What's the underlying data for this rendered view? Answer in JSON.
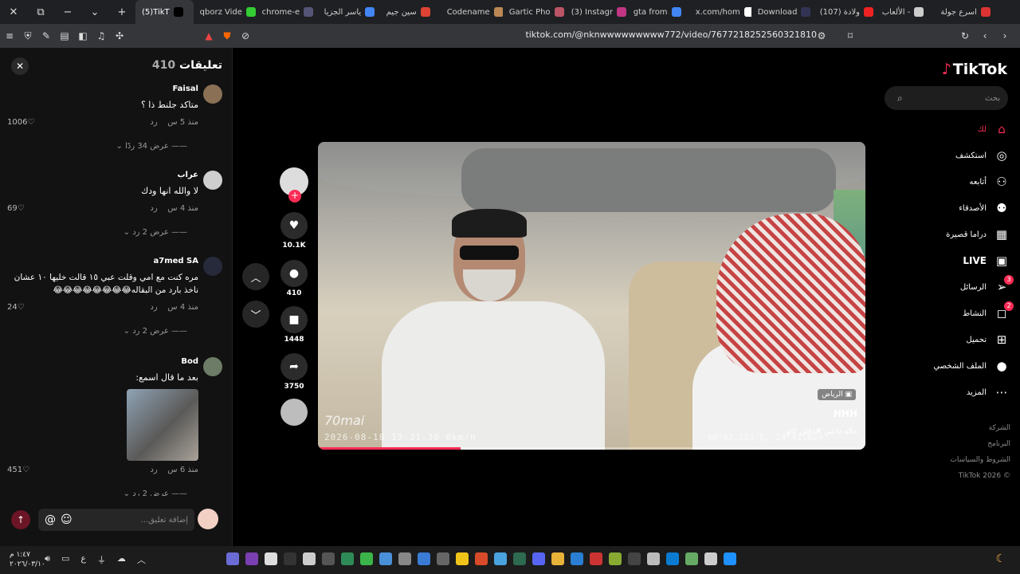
{
  "browser": {
    "tabs": [
      {
        "label": "اسرع جولة",
        "color": "#d33"
      },
      {
        "label": "الألعاب - ",
        "color": "#ccc"
      },
      {
        "label": "(107) ولادة",
        "color": "#e22"
      },
      {
        "label": "Download",
        "color": "#335"
      },
      {
        "label": "x.com/hom",
        "color": "#fff"
      },
      {
        "label": "gta from",
        "color": "#4285f4"
      },
      {
        "label": "(3) Instagr",
        "color": "#c13584"
      },
      {
        "label": "Gartic Pho",
        "color": "#b56"
      },
      {
        "label": "Codename",
        "color": "#b85"
      },
      {
        "label": "سين جيم",
        "color": "#d43"
      },
      {
        "label": "ياسر الجزيا",
        "color": "#4285f4"
      },
      {
        "label": "chrome-e",
        "color": "#557"
      },
      {
        "label": "qborz Vide",
        "color": "#3c3"
      },
      {
        "label": "(5)TikT",
        "color": "#000"
      }
    ],
    "url": "tiktok.com/@nknwwwwwwwww772/video/7677218252560321810"
  },
  "comments": {
    "title": "تعليقات",
    "count": "410",
    "input_placeholder": "إضافة تعليق...",
    "at_icon": "@",
    "items": [
      {
        "user": "Faisal",
        "text": "متاكد جلنط ذا ؟",
        "time": "منذ 5 س",
        "reply": "رد",
        "likes": "1006",
        "replies": "عرض 34 ردًا",
        "avatar": "#8a7155"
      },
      {
        "user": "عراب",
        "text": "لا والله انها ودك",
        "time": "منذ 4 س",
        "reply": "رد",
        "likes": "69",
        "replies": "عرض 2 رد",
        "avatar": "#cfcfcf"
      },
      {
        "user": "a7med SA",
        "text": "مره كنت مع امي وقلت عبي ١٥ قالت خليها ١٠ عشان",
        "text2": "ناخذ بارد من البقاله😂😂😂😂😂😂😂😂",
        "time": "منذ 4 س",
        "reply": "رد",
        "likes": "24",
        "replies": "عرض 2 رد",
        "avatar": "#262a3a"
      },
      {
        "user": "Bod",
        "text": "بعد ما قال اسمع:",
        "time": "منذ 6 س",
        "reply": "رد",
        "likes": "451",
        "replies": "عرض 2 رد",
        "avatar": "#6c7c66"
      }
    ]
  },
  "video": {
    "watermark": "70mai",
    "timestamp": "2026-08-18 13:31:30   0km/h",
    "coords": "46°42.253'E, 24°41.824",
    "location": "الرياض",
    "author": "HHH",
    "caption": "ماله داعي #داش كام",
    "progress_percent": 26
  },
  "actions": [
    {
      "name": "like",
      "icon": "♥",
      "count": "10.1K"
    },
    {
      "name": "comment",
      "icon": "●",
      "count": "410"
    },
    {
      "name": "save",
      "icon": "■",
      "count": "1448"
    },
    {
      "name": "share",
      "icon": "➦",
      "count": "3750"
    }
  ],
  "sidebar": {
    "logo": "TikTok",
    "search_placeholder": "بحث",
    "items": [
      {
        "label": "لك",
        "icon": "⌂",
        "active": true
      },
      {
        "label": "استكشف",
        "icon": "◎"
      },
      {
        "label": "أتابعه",
        "icon": "⚇"
      },
      {
        "label": "الأصدقاء",
        "icon": "⚉"
      },
      {
        "label": "دراما قصيرة",
        "icon": "▦"
      },
      {
        "label": "LIVE",
        "icon": "▣",
        "bold": true
      },
      {
        "label": "الرسائل",
        "icon": "➢",
        "badge": "3"
      },
      {
        "label": "النشاط",
        "icon": "◻",
        "badge": "2"
      },
      {
        "label": "تحميل",
        "icon": "⊞"
      },
      {
        "label": "الملف الشخصي",
        "icon": "●"
      },
      {
        "label": "المزيد",
        "icon": "⋯"
      }
    ],
    "footer": [
      "الشركة",
      "البرنامج",
      "الشروط والسياسات",
      "© 2026 TikTok"
    ]
  },
  "taskbar": {
    "time": "١:٤٧ م",
    "date": "٢٠٢٦/٠٣/١٠",
    "lang": "ع"
  }
}
